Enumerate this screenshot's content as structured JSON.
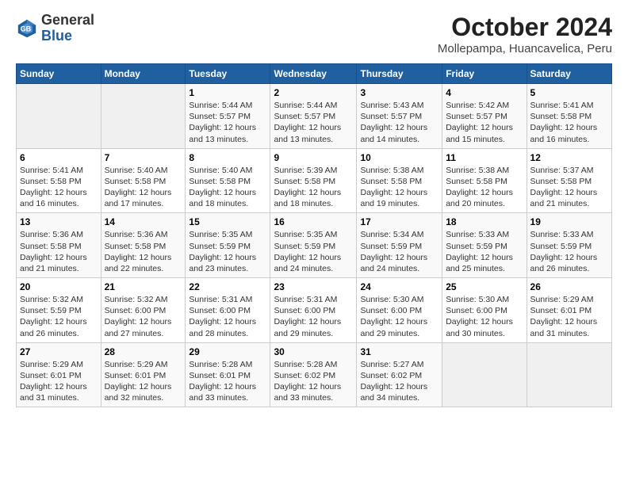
{
  "logo": {
    "general": "General",
    "blue": "Blue"
  },
  "title": "October 2024",
  "subtitle": "Mollepampa, Huancavelica, Peru",
  "days_of_week": [
    "Sunday",
    "Monday",
    "Tuesday",
    "Wednesday",
    "Thursday",
    "Friday",
    "Saturday"
  ],
  "weeks": [
    [
      {
        "day": "",
        "sunrise": "",
        "sunset": "",
        "daylight": ""
      },
      {
        "day": "",
        "sunrise": "",
        "sunset": "",
        "daylight": ""
      },
      {
        "day": "1",
        "sunrise": "Sunrise: 5:44 AM",
        "sunset": "Sunset: 5:57 PM",
        "daylight": "Daylight: 12 hours and 13 minutes."
      },
      {
        "day": "2",
        "sunrise": "Sunrise: 5:44 AM",
        "sunset": "Sunset: 5:57 PM",
        "daylight": "Daylight: 12 hours and 13 minutes."
      },
      {
        "day": "3",
        "sunrise": "Sunrise: 5:43 AM",
        "sunset": "Sunset: 5:57 PM",
        "daylight": "Daylight: 12 hours and 14 minutes."
      },
      {
        "day": "4",
        "sunrise": "Sunrise: 5:42 AM",
        "sunset": "Sunset: 5:57 PM",
        "daylight": "Daylight: 12 hours and 15 minutes."
      },
      {
        "day": "5",
        "sunrise": "Sunrise: 5:41 AM",
        "sunset": "Sunset: 5:58 PM",
        "daylight": "Daylight: 12 hours and 16 minutes."
      }
    ],
    [
      {
        "day": "6",
        "sunrise": "Sunrise: 5:41 AM",
        "sunset": "Sunset: 5:58 PM",
        "daylight": "Daylight: 12 hours and 16 minutes."
      },
      {
        "day": "7",
        "sunrise": "Sunrise: 5:40 AM",
        "sunset": "Sunset: 5:58 PM",
        "daylight": "Daylight: 12 hours and 17 minutes."
      },
      {
        "day": "8",
        "sunrise": "Sunrise: 5:40 AM",
        "sunset": "Sunset: 5:58 PM",
        "daylight": "Daylight: 12 hours and 18 minutes."
      },
      {
        "day": "9",
        "sunrise": "Sunrise: 5:39 AM",
        "sunset": "Sunset: 5:58 PM",
        "daylight": "Daylight: 12 hours and 18 minutes."
      },
      {
        "day": "10",
        "sunrise": "Sunrise: 5:38 AM",
        "sunset": "Sunset: 5:58 PM",
        "daylight": "Daylight: 12 hours and 19 minutes."
      },
      {
        "day": "11",
        "sunrise": "Sunrise: 5:38 AM",
        "sunset": "Sunset: 5:58 PM",
        "daylight": "Daylight: 12 hours and 20 minutes."
      },
      {
        "day": "12",
        "sunrise": "Sunrise: 5:37 AM",
        "sunset": "Sunset: 5:58 PM",
        "daylight": "Daylight: 12 hours and 21 minutes."
      }
    ],
    [
      {
        "day": "13",
        "sunrise": "Sunrise: 5:36 AM",
        "sunset": "Sunset: 5:58 PM",
        "daylight": "Daylight: 12 hours and 21 minutes."
      },
      {
        "day": "14",
        "sunrise": "Sunrise: 5:36 AM",
        "sunset": "Sunset: 5:58 PM",
        "daylight": "Daylight: 12 hours and 22 minutes."
      },
      {
        "day": "15",
        "sunrise": "Sunrise: 5:35 AM",
        "sunset": "Sunset: 5:59 PM",
        "daylight": "Daylight: 12 hours and 23 minutes."
      },
      {
        "day": "16",
        "sunrise": "Sunrise: 5:35 AM",
        "sunset": "Sunset: 5:59 PM",
        "daylight": "Daylight: 12 hours and 24 minutes."
      },
      {
        "day": "17",
        "sunrise": "Sunrise: 5:34 AM",
        "sunset": "Sunset: 5:59 PM",
        "daylight": "Daylight: 12 hours and 24 minutes."
      },
      {
        "day": "18",
        "sunrise": "Sunrise: 5:33 AM",
        "sunset": "Sunset: 5:59 PM",
        "daylight": "Daylight: 12 hours and 25 minutes."
      },
      {
        "day": "19",
        "sunrise": "Sunrise: 5:33 AM",
        "sunset": "Sunset: 5:59 PM",
        "daylight": "Daylight: 12 hours and 26 minutes."
      }
    ],
    [
      {
        "day": "20",
        "sunrise": "Sunrise: 5:32 AM",
        "sunset": "Sunset: 5:59 PM",
        "daylight": "Daylight: 12 hours and 26 minutes."
      },
      {
        "day": "21",
        "sunrise": "Sunrise: 5:32 AM",
        "sunset": "Sunset: 6:00 PM",
        "daylight": "Daylight: 12 hours and 27 minutes."
      },
      {
        "day": "22",
        "sunrise": "Sunrise: 5:31 AM",
        "sunset": "Sunset: 6:00 PM",
        "daylight": "Daylight: 12 hours and 28 minutes."
      },
      {
        "day": "23",
        "sunrise": "Sunrise: 5:31 AM",
        "sunset": "Sunset: 6:00 PM",
        "daylight": "Daylight: 12 hours and 29 minutes."
      },
      {
        "day": "24",
        "sunrise": "Sunrise: 5:30 AM",
        "sunset": "Sunset: 6:00 PM",
        "daylight": "Daylight: 12 hours and 29 minutes."
      },
      {
        "day": "25",
        "sunrise": "Sunrise: 5:30 AM",
        "sunset": "Sunset: 6:00 PM",
        "daylight": "Daylight: 12 hours and 30 minutes."
      },
      {
        "day": "26",
        "sunrise": "Sunrise: 5:29 AM",
        "sunset": "Sunset: 6:01 PM",
        "daylight": "Daylight: 12 hours and 31 minutes."
      }
    ],
    [
      {
        "day": "27",
        "sunrise": "Sunrise: 5:29 AM",
        "sunset": "Sunset: 6:01 PM",
        "daylight": "Daylight: 12 hours and 31 minutes."
      },
      {
        "day": "28",
        "sunrise": "Sunrise: 5:29 AM",
        "sunset": "Sunset: 6:01 PM",
        "daylight": "Daylight: 12 hours and 32 minutes."
      },
      {
        "day": "29",
        "sunrise": "Sunrise: 5:28 AM",
        "sunset": "Sunset: 6:01 PM",
        "daylight": "Daylight: 12 hours and 33 minutes."
      },
      {
        "day": "30",
        "sunrise": "Sunrise: 5:28 AM",
        "sunset": "Sunset: 6:02 PM",
        "daylight": "Daylight: 12 hours and 33 minutes."
      },
      {
        "day": "31",
        "sunrise": "Sunrise: 5:27 AM",
        "sunset": "Sunset: 6:02 PM",
        "daylight": "Daylight: 12 hours and 34 minutes."
      },
      {
        "day": "",
        "sunrise": "",
        "sunset": "",
        "daylight": ""
      },
      {
        "day": "",
        "sunrise": "",
        "sunset": "",
        "daylight": ""
      }
    ]
  ]
}
